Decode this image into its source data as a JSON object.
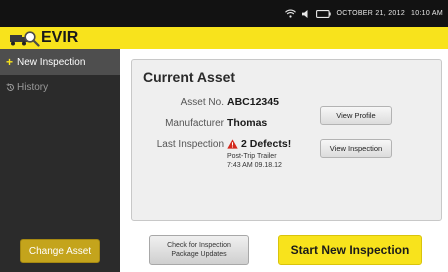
{
  "status_bar": {
    "date": "OCTOBER 21, 2012",
    "time": "10:10 AM",
    "icons": [
      "wifi-icon",
      "volume-icon",
      "battery-icon"
    ]
  },
  "app": {
    "title": "EVIR",
    "logo": "truck-search-logo",
    "accent_color": "#f8e31c"
  },
  "sidebar": {
    "items": [
      {
        "icon": "plus-icon",
        "label": "New Inspection",
        "active": true
      },
      {
        "icon": "history-icon",
        "label": "History",
        "active": false
      }
    ],
    "change_asset_label": "Change Asset"
  },
  "asset_card": {
    "title": "Current Asset",
    "asset_no_label": "Asset No.",
    "asset_no": "ABC12345",
    "manufacturer_label": "Manufacturer",
    "manufacturer": "Thomas",
    "last_inspection_label": "Last Inspection",
    "defects_text": "2 Defects!",
    "inspection_type": "Post-Trip Trailer",
    "inspection_time": "7:43 AM 09.18.12",
    "view_profile_label": "View Profile",
    "view_inspection_label": "View Inspection"
  },
  "actions": {
    "check_updates_line1": "Check for Inspection",
    "check_updates_line2": "Package Updates",
    "start_new_label": "Start New Inspection"
  }
}
